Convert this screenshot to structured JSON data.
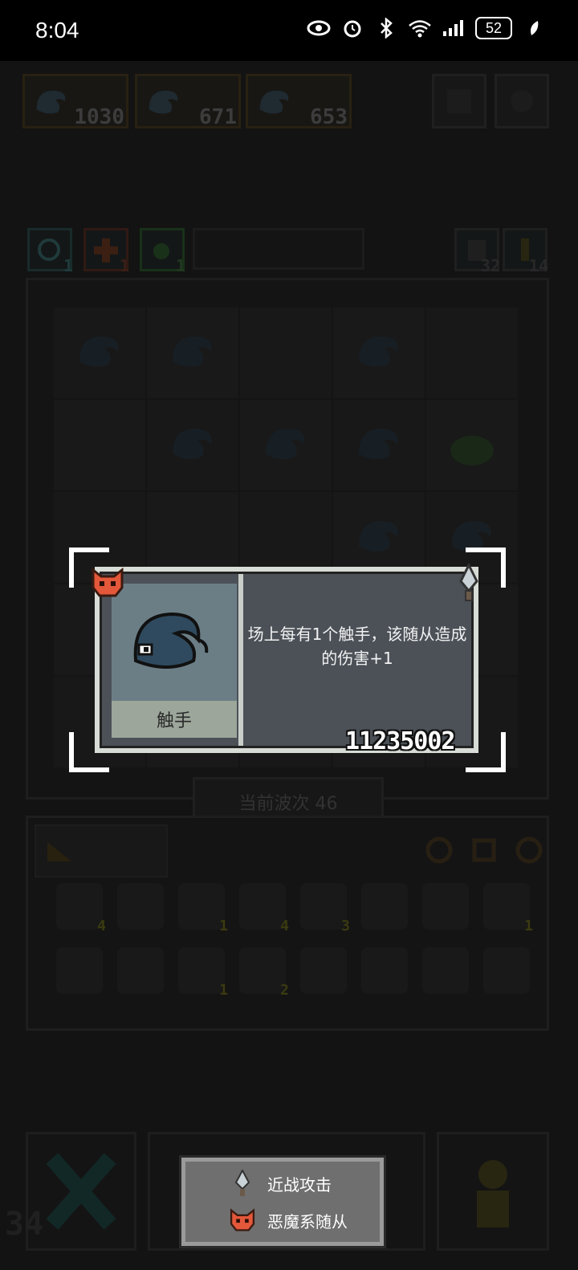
{
  "status_bar": {
    "time": "8:04",
    "battery": "52"
  },
  "top_slots": [
    {
      "count": "1030"
    },
    {
      "count": "671"
    },
    {
      "count": "653"
    }
  ],
  "top_buttons": [
    "help-icon",
    "settings-icon"
  ],
  "chips": [
    {
      "count": "1",
      "icon": "clock-icon"
    },
    {
      "count": "1",
      "icon": "plus-icon"
    },
    {
      "count": "1",
      "icon": "leaf-icon"
    }
  ],
  "right_counters": [
    {
      "count": "32",
      "icon": "exit-icon"
    },
    {
      "count": "14",
      "icon": "key-icon"
    }
  ],
  "wave_label": "当前波次 46",
  "card": {
    "name": "触手",
    "description": "场上每有1个触手，该随从造成的伤害+1",
    "id_number": "11235002",
    "left_badge": "demon-mask-icon",
    "right_badge": "dagger-icon"
  },
  "inventory": {
    "row1_counts": [
      "4",
      "",
      "1",
      "4",
      "3",
      "",
      "",
      "1"
    ],
    "row2_counts": [
      "",
      "",
      "1",
      "2",
      "",
      "",
      "",
      ""
    ]
  },
  "legend": {
    "items": [
      {
        "label": "近战攻击",
        "icon": "dagger-icon"
      },
      {
        "label": "恶魔系随从",
        "icon": "demon-mask-icon"
      }
    ]
  },
  "corner_counter": "34",
  "colors": {
    "card_bg": "#4c5158",
    "portrait_bg": "#6b7e86",
    "demon": "#e3573a",
    "tentacle": "#2f4a5e"
  }
}
